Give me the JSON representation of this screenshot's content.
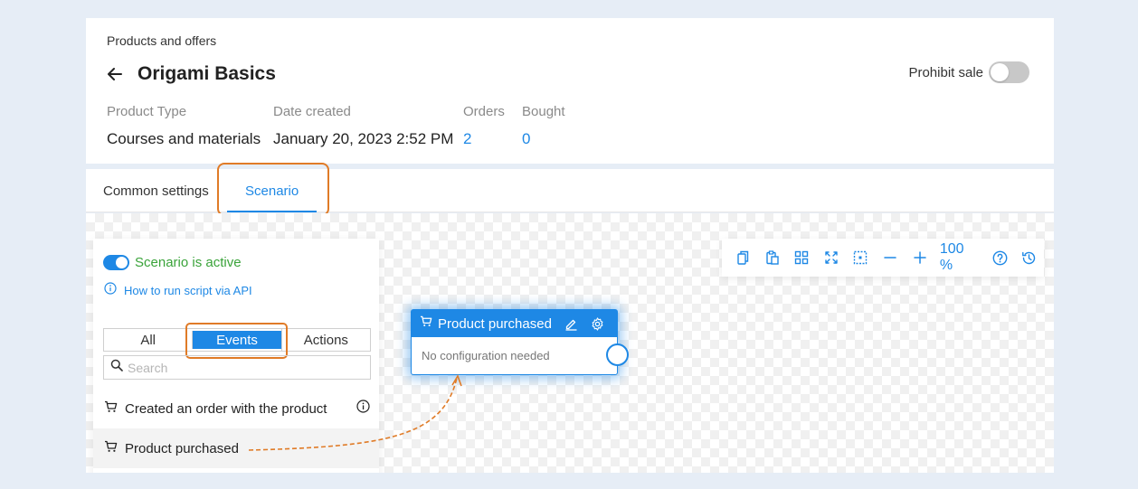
{
  "header": {
    "breadcrumb": "Products and offers",
    "title": "Origami Basics",
    "prohibit_sale_label": "Prohibit sale",
    "meta": [
      {
        "label": "Product Type",
        "value": "Courses and materials"
      },
      {
        "label": "Date created",
        "value": "January 20, 2023 2:52 PM"
      },
      {
        "label": "Orders",
        "value": "2"
      },
      {
        "label": "Bought",
        "value": "0"
      }
    ]
  },
  "tabs": {
    "common": "Common settings",
    "scenario": "Scenario"
  },
  "panel": {
    "active_label": "Scenario is active",
    "api_link": "How to run script via API",
    "filters": [
      "All",
      "Events",
      "Actions"
    ],
    "search_placeholder": "Search",
    "events": [
      "Created an order with the product",
      "Product purchased"
    ]
  },
  "toolbar": {
    "zoom": "100 %"
  },
  "node": {
    "title": "Product purchased",
    "body": "No configuration needed"
  },
  "colors": {
    "accent": "#1e88e5",
    "active": "#3aa33a",
    "highlight": "#e07b27"
  }
}
